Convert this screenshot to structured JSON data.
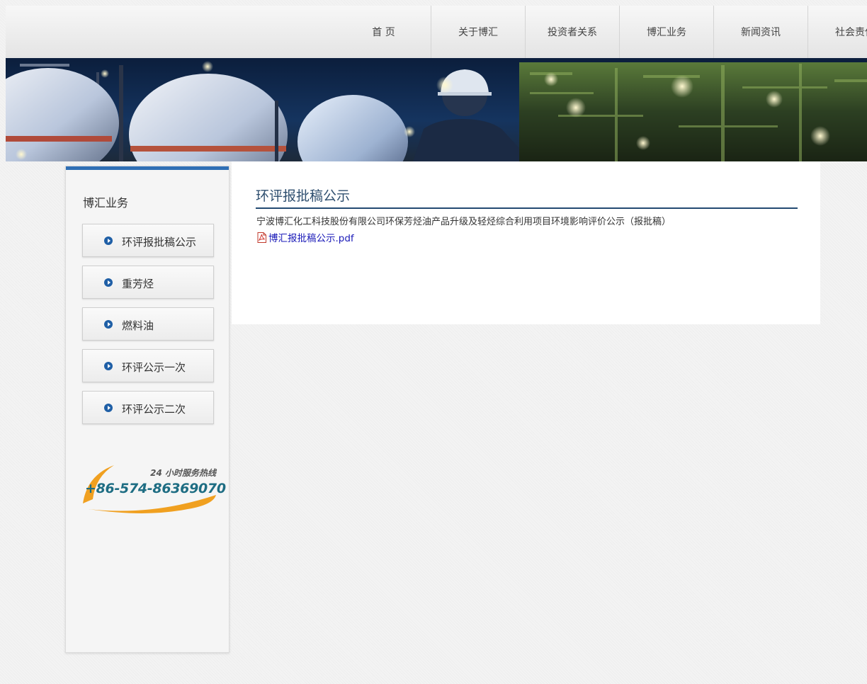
{
  "nav": {
    "items": [
      {
        "label": "首 页"
      },
      {
        "label": "关于博汇"
      },
      {
        "label": "投资者关系"
      },
      {
        "label": "博汇业务"
      },
      {
        "label": "新闻资讯"
      },
      {
        "label": "社会责任"
      }
    ]
  },
  "banner": {
    "icon": "industrial-night-scene"
  },
  "sidebar": {
    "title": "博汇业务",
    "items": [
      {
        "label": "环评报批稿公示"
      },
      {
        "label": "重芳烃"
      },
      {
        "label": "燃料油"
      },
      {
        "label": "环评公示一次"
      },
      {
        "label": "环评公示二次"
      }
    ],
    "hotline": {
      "title": "24 小时服务热线",
      "number": "+86-574-86369070"
    }
  },
  "content": {
    "title": "环评报批稿公示",
    "description": "宁波博汇化工科技股份有限公司环保芳烃油产品升级及轻烃综合利用项目环境影响评价公示（报批稿）",
    "attachment": {
      "name": "博汇报批稿公示.pdf",
      "icon": "pdf-icon"
    }
  },
  "colors": {
    "accent": "#2f6fb5",
    "title_rule": "#234a72",
    "link": "#1a1ab8",
    "hotline_number": "#1e6d83",
    "hotline_swoosh": "#f0a020"
  }
}
